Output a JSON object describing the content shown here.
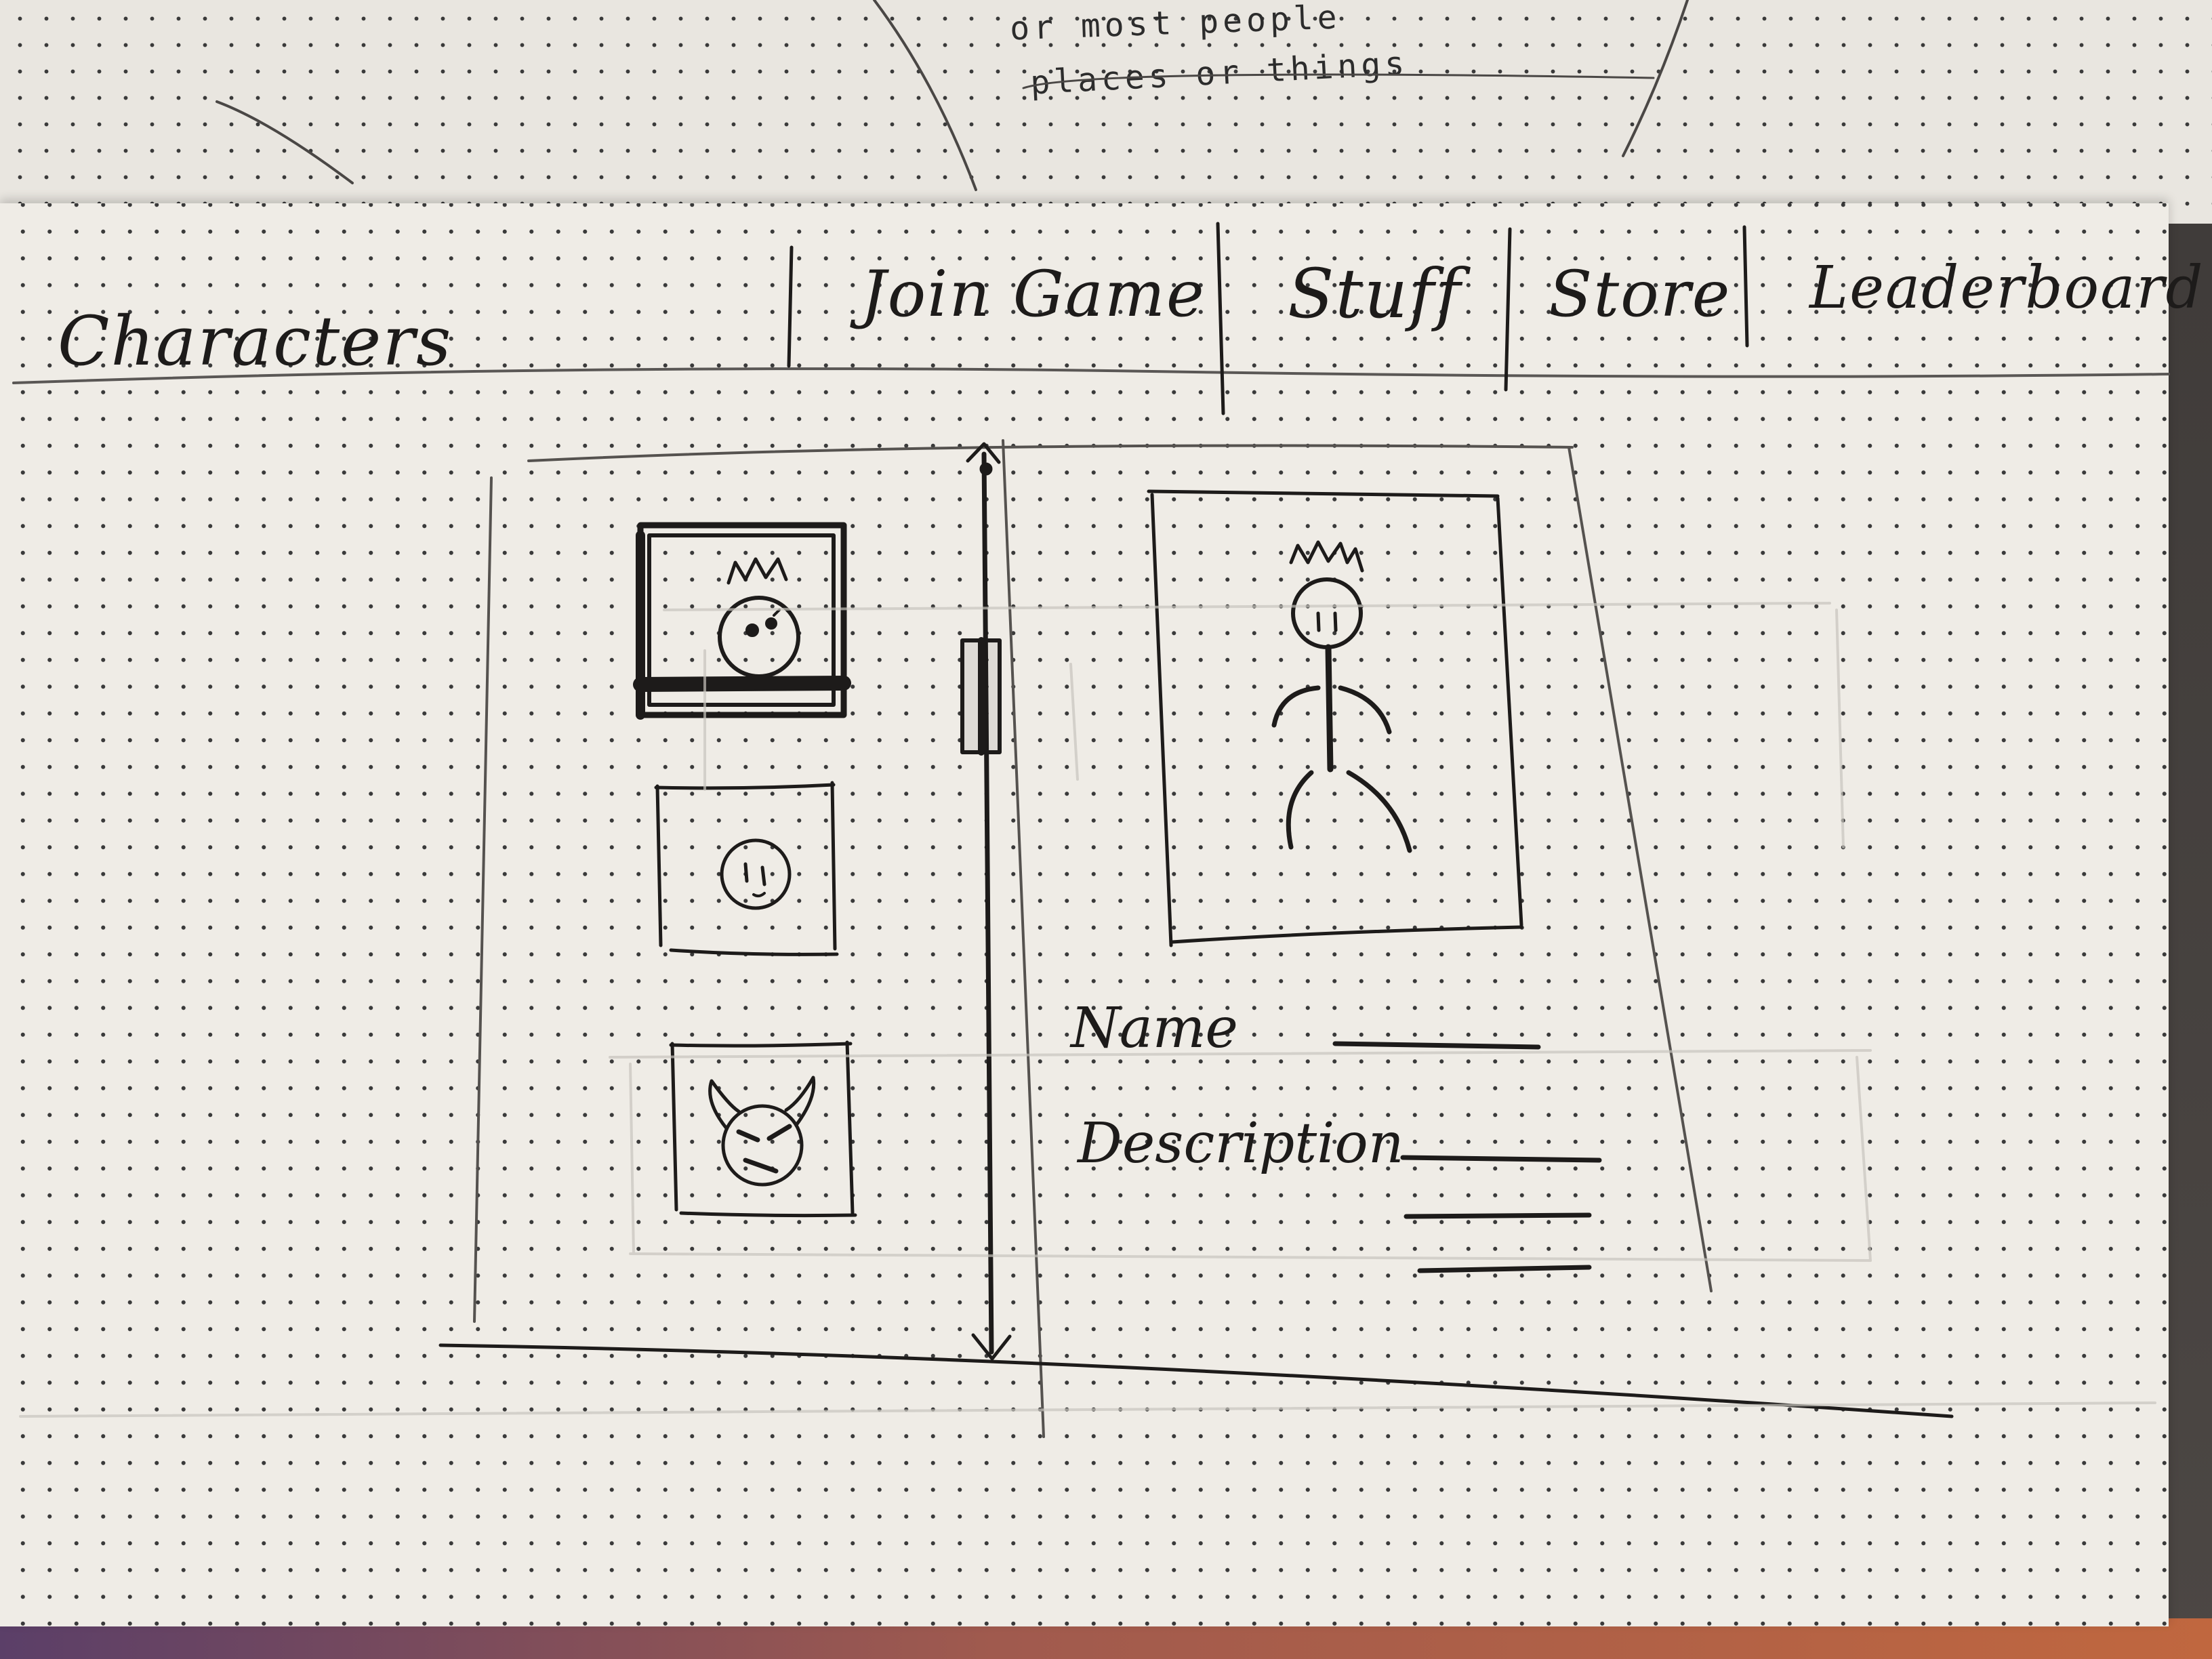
{
  "back_page": {
    "line1": "or most people",
    "line2": "places or things"
  },
  "nav": {
    "tabs": [
      {
        "label": "Characters"
      },
      {
        "label": "Join Game"
      },
      {
        "label": "Stuff"
      },
      {
        "label": "Store"
      },
      {
        "label": "Leaderboard"
      }
    ]
  },
  "character_list": {
    "items": [
      {
        "icon": "king-face-icon",
        "selected": true
      },
      {
        "icon": "smiley-face-icon",
        "selected": false
      },
      {
        "icon": "devil-face-icon",
        "selected": false
      }
    ]
  },
  "detail": {
    "portrait_icon": "king-stick-figure-icon",
    "name_label": "Name",
    "description_label": "Description"
  }
}
